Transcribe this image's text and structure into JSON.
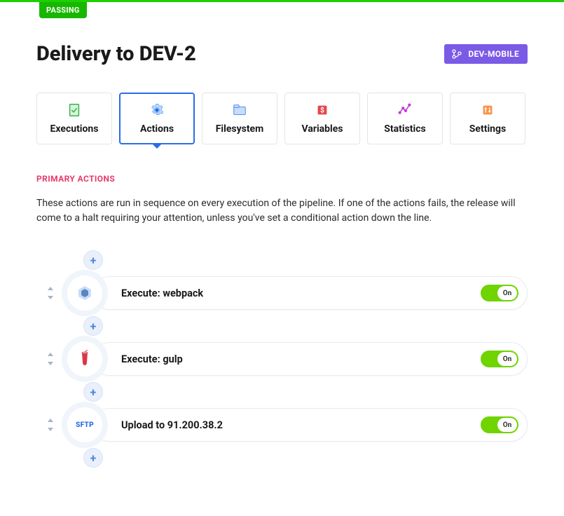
{
  "status_badge": "PASSING",
  "page_title": "Delivery to DEV-2",
  "header_button": "DEV-MOBILE",
  "tabs": [
    {
      "label": "Executions"
    },
    {
      "label": "Actions"
    },
    {
      "label": "Filesystem"
    },
    {
      "label": "Variables"
    },
    {
      "label": "Statistics"
    },
    {
      "label": "Settings"
    }
  ],
  "section": {
    "heading": "PRIMARY ACTIONS",
    "description": "These actions are run in sequence on every execution of the pipeline. If one of the actions fails, the release will come to a halt requiring your attention, unless you've set a conditional action down the line."
  },
  "actions": [
    {
      "title": "Execute: webpack",
      "toggle": "On",
      "icon": "webpack"
    },
    {
      "title": "Execute: gulp",
      "toggle": "On",
      "icon": "gulp"
    },
    {
      "title": "Upload to 91.200.38.2",
      "toggle": "On",
      "icon": "sftp",
      "icon_text": "SFTP"
    }
  ]
}
